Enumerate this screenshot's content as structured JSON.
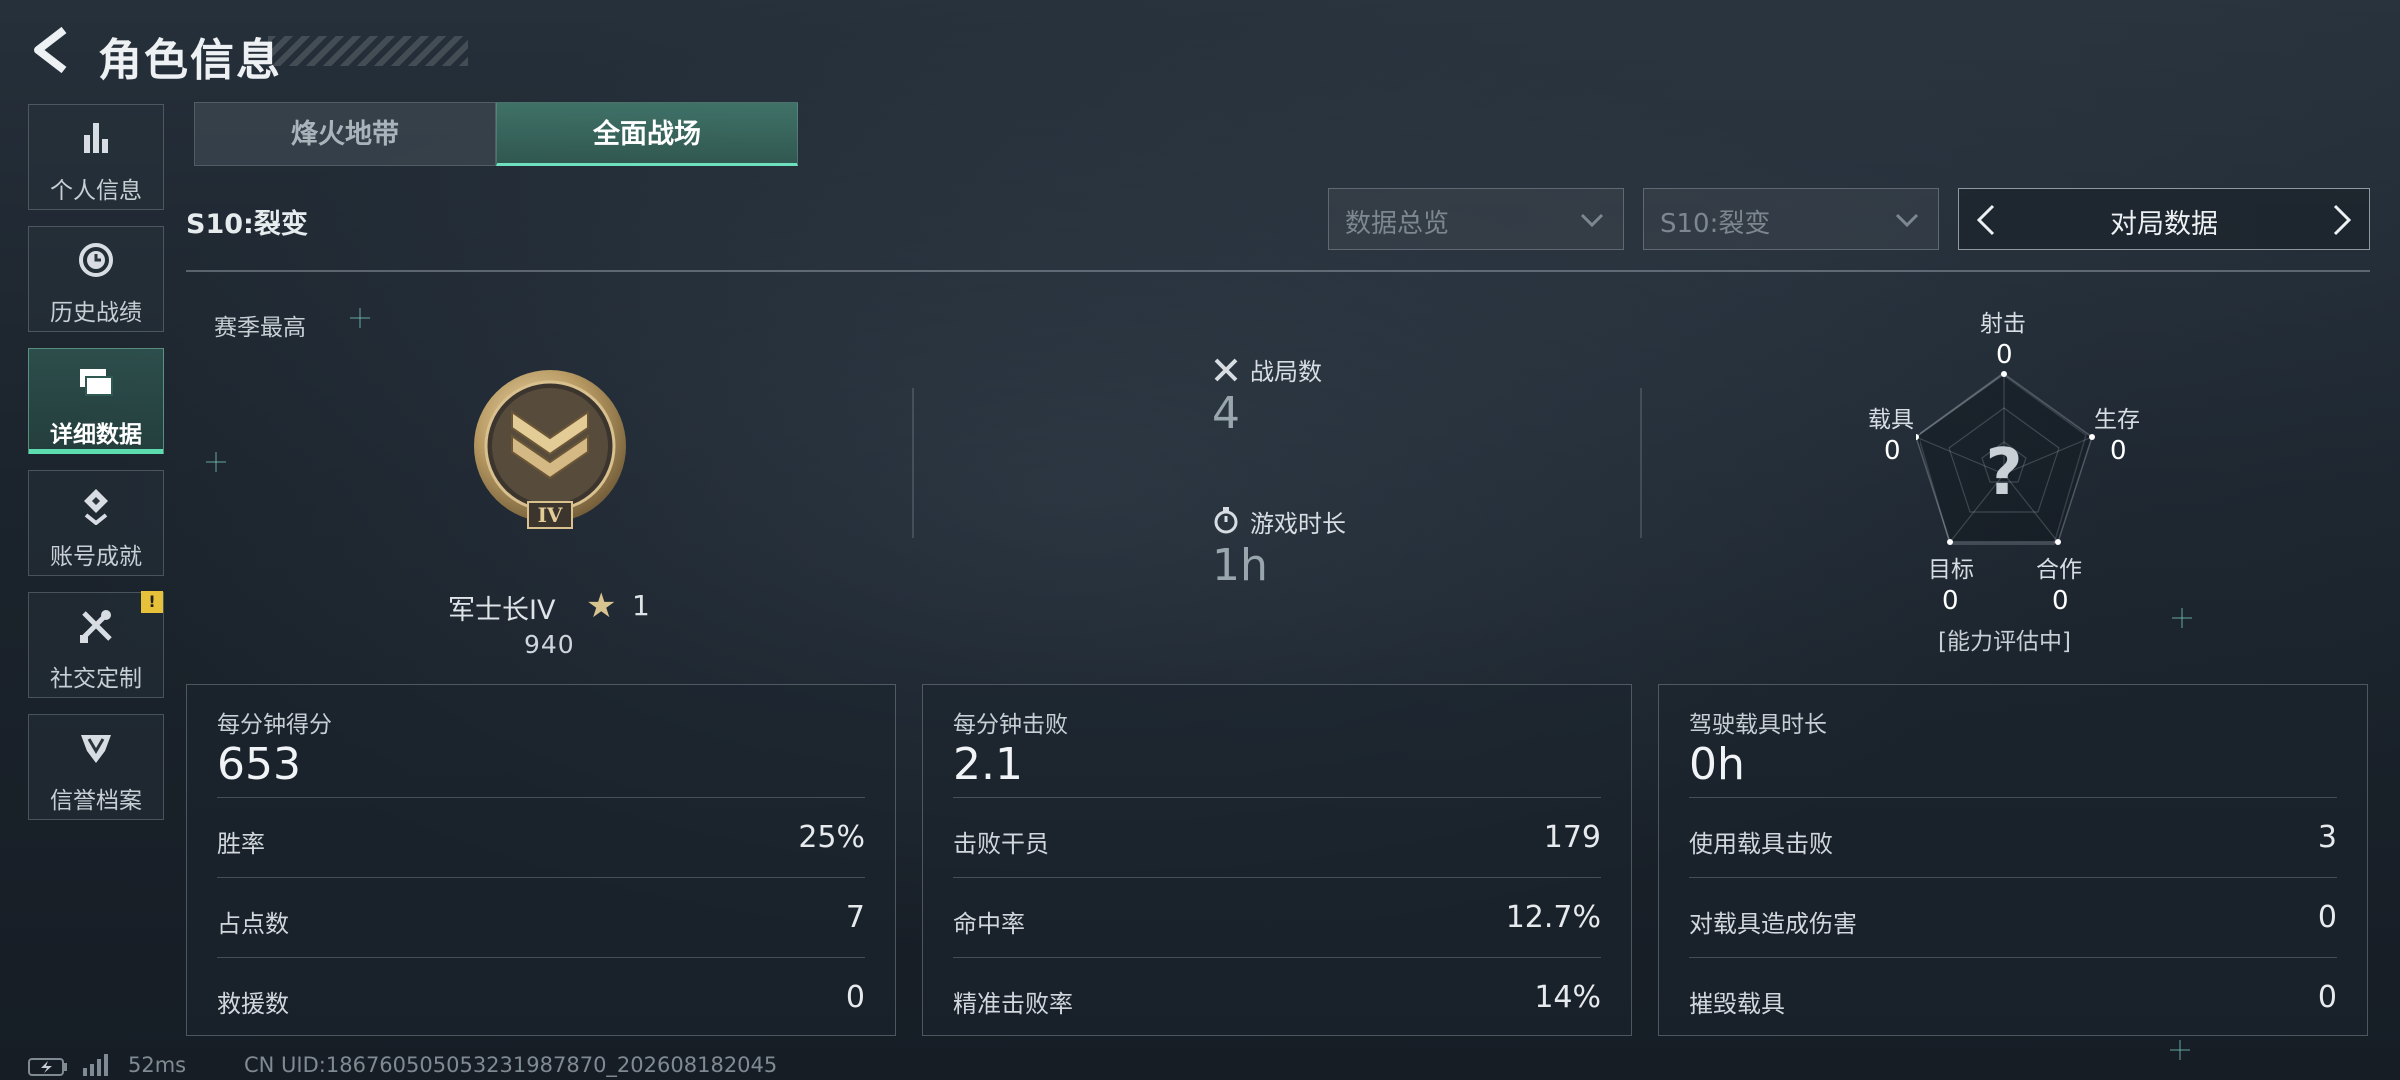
{
  "header": {
    "title": "角色信息"
  },
  "sidebar": {
    "items": [
      {
        "label": "个人信息",
        "icon": "bar-chart-icon"
      },
      {
        "label": "历史战绩",
        "icon": "history-clock-icon"
      },
      {
        "label": "详细数据",
        "icon": "folders-icon",
        "active": true
      },
      {
        "label": "账号成就",
        "icon": "achievement-icon"
      },
      {
        "label": "社交定制",
        "icon": "tools-icon",
        "badge": "!"
      },
      {
        "label": "信誉档案",
        "icon": "emblem-icon"
      }
    ]
  },
  "mode_tabs": [
    {
      "label": "烽火地带",
      "active": false
    },
    {
      "label": "全面战场",
      "active": true
    }
  ],
  "season_label": "S10:裂变",
  "filters": {
    "data_scope": "数据总览",
    "season": "S10:裂变",
    "category": "对局数据"
  },
  "rank": {
    "section_label": "赛季最高",
    "name": "军士长IV",
    "roman": "IV",
    "star_count": "1",
    "score": "940"
  },
  "overview": {
    "matches_label": "战局数",
    "matches_value": "4",
    "time_label": "游戏时长",
    "time_value": "1h"
  },
  "radar": {
    "axes": [
      {
        "label": "射击",
        "value": "0"
      },
      {
        "label": "生存",
        "value": "0"
      },
      {
        "label": "合作",
        "value": "0"
      },
      {
        "label": "目标",
        "value": "0"
      },
      {
        "label": "载具",
        "value": "0"
      }
    ],
    "center_symbol": "?",
    "status": "[能力评估中]"
  },
  "cards": [
    {
      "header_label": "每分钟得分",
      "header_value": "653",
      "rows": [
        {
          "label": "胜率",
          "value": "25%"
        },
        {
          "label": "占点数",
          "value": "7"
        },
        {
          "label": "救援数",
          "value": "0"
        }
      ]
    },
    {
      "header_label": "每分钟击败",
      "header_value": "2.1",
      "rows": [
        {
          "label": "击败干员",
          "value": "179"
        },
        {
          "label": "命中率",
          "value": "12.7%"
        },
        {
          "label": "精准击败率",
          "value": "14%"
        }
      ]
    },
    {
      "header_label": "驾驶载具时长",
      "header_value": "0h",
      "rows": [
        {
          "label": "使用载具击败",
          "value": "3"
        },
        {
          "label": "对载具造成伤害",
          "value": "0"
        },
        {
          "label": "摧毁载具",
          "value": "0"
        }
      ]
    }
  ],
  "footer": {
    "ping": "52ms",
    "uid": "CN UID:18676050505323198787​0_202608182045"
  },
  "colors": {
    "accent": "#5ddcb0",
    "badge": "#e7c13a"
  }
}
